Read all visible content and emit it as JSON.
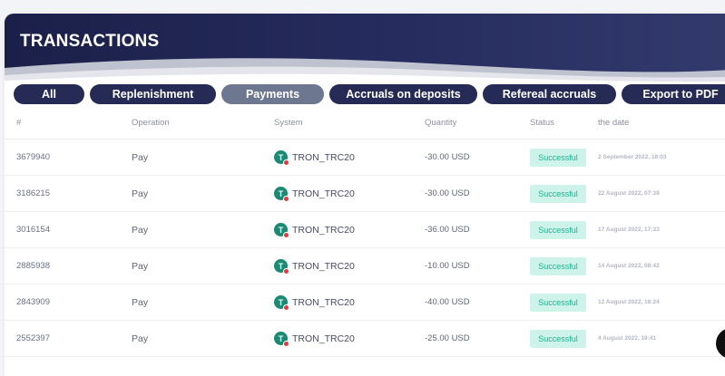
{
  "header": {
    "title": "TRANSACTIONS"
  },
  "tabs": [
    {
      "label": "All"
    },
    {
      "label": "Replenishment"
    },
    {
      "label": "Payments"
    },
    {
      "label": "Accruals on deposits"
    },
    {
      "label": "Refereal accruals"
    },
    {
      "label": "Export to PDF"
    }
  ],
  "active_tab": "Payments",
  "table": {
    "columns": [
      "#",
      "Operation",
      "System",
      "Quantity",
      "Status",
      "the date"
    ],
    "rows": [
      {
        "id": "3679940",
        "operation": "Pay",
        "system": "TRON_TRC20",
        "quantity": "-30.00 USD",
        "status": "Successful",
        "date": "2 September 2022, 18:03"
      },
      {
        "id": "3186215",
        "operation": "Pay",
        "system": "TRON_TRC20",
        "quantity": "-30.00 USD",
        "status": "Successful",
        "date": "22 August 2022, 07:39"
      },
      {
        "id": "3016154",
        "operation": "Pay",
        "system": "TRON_TRC20",
        "quantity": "-36.00 USD",
        "status": "Successful",
        "date": "17 August 2022, 17:33"
      },
      {
        "id": "2885938",
        "operation": "Pay",
        "system": "TRON_TRC20",
        "quantity": "-10.00 USD",
        "status": "Successful",
        "date": "14 August 2022, 08:42"
      },
      {
        "id": "2843909",
        "operation": "Pay",
        "system": "TRON_TRC20",
        "quantity": "-40.00 USD",
        "status": "Successful",
        "date": "12 August 2022, 18:24"
      },
      {
        "id": "2552397",
        "operation": "Pay",
        "system": "TRON_TRC20",
        "quantity": "-25.00 USD",
        "status": "Successful",
        "date": "4 August 2022, 19:41"
      }
    ]
  },
  "colors": {
    "header_bg": "#1b2049",
    "tab_bg": "#262b55",
    "tab_active_bg": "#6d7790",
    "status_bg": "#cdf3ea",
    "status_text": "#1bb38f",
    "system_icon": "#1a8a74"
  },
  "icons": {
    "system": "tether-icon"
  }
}
